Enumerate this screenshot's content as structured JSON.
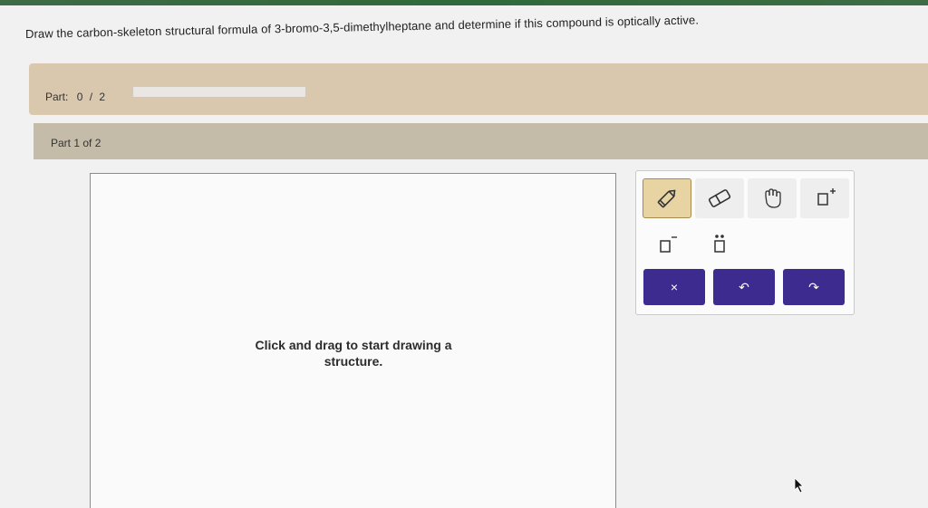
{
  "question": {
    "text": "Draw the carbon-skeleton structural formula of 3-bromo-3,5-dimethylheptane and determine if this compound is optically active."
  },
  "progress": {
    "label": "Part:",
    "current": "0",
    "separator": "/",
    "total": "2",
    "fraction_complete": 0
  },
  "part_header": {
    "label": "Part 1 of 2"
  },
  "canvas": {
    "hint_line1": "Click and drag to start drawing a",
    "hint_line2": "structure."
  },
  "toolbar": {
    "tools": [
      {
        "icon": "pencil-icon",
        "active": true
      },
      {
        "icon": "eraser-icon",
        "active": false
      },
      {
        "icon": "hand-icon",
        "active": false
      },
      {
        "icon": "charge-plus-icon",
        "active": false
      },
      {
        "icon": "charge-minus-icon",
        "active": false
      },
      {
        "icon": "lone-pair-icon",
        "active": false
      }
    ],
    "actions": [
      {
        "icon": "clear-icon",
        "label": "×"
      },
      {
        "icon": "undo-icon",
        "label": "↶"
      },
      {
        "icon": "redo-icon",
        "label": "↷"
      }
    ],
    "action_color": "#3d2b8f",
    "active_tool_color": "#e8d4a3"
  },
  "colors": {
    "part_bar": "#d9c8ae",
    "part_header": "#c4bca9"
  }
}
